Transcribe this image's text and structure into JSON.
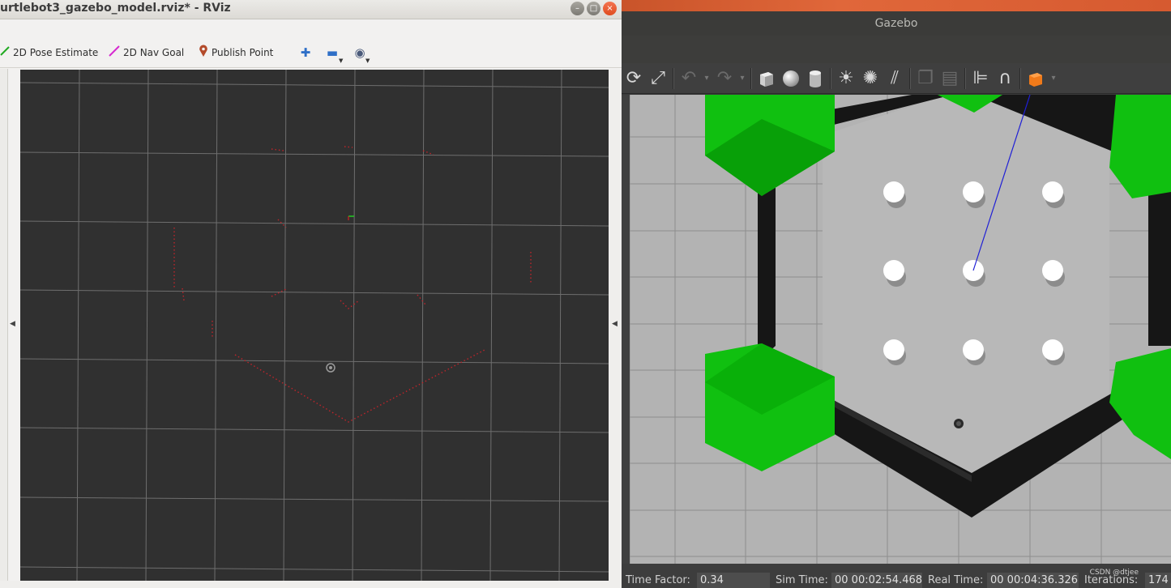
{
  "rviz": {
    "title": "urtlebot3_gazebo_model.rviz* - RViz",
    "window_buttons": {
      "minimize": "–",
      "maximize": "□",
      "close": "×"
    },
    "tools": [
      {
        "label": "2D Pose Estimate",
        "icon": "green-arrow-icon",
        "color": "#22aa22"
      },
      {
        "label": "2D Nav Goal",
        "icon": "pink-arrow-icon",
        "color": "#d62ad0"
      },
      {
        "label": "Publish Point",
        "icon": "map-pin-icon",
        "color": "#b34a2a"
      }
    ],
    "toolbar_icons": [
      "plus-icon",
      "minus-icon",
      "eye-icon"
    ],
    "viewport_bg": "#303030",
    "scan_color": "#c0242a"
  },
  "gazebo": {
    "title": "Gazebo",
    "accent": "#e0673a",
    "status": {
      "time_factor_label": "Time Factor:",
      "time_factor_value": "0.34",
      "sim_time_label": "Sim Time:",
      "sim_time_value": "00 00:02:54.468",
      "real_time_label": "Real Time:",
      "real_time_value": "00 00:04:36.326",
      "iterations_label": "Iterations:",
      "iterations_value": "174"
    },
    "watermark": "CSDN @dtjee",
    "toolbar_icons": [
      "rotate-icon",
      "scale-icon",
      "undo-icon",
      "redo-icon",
      "box-icon",
      "sphere-icon",
      "cylinder-icon",
      "point-light-icon",
      "spot-light-icon",
      "directional-light-icon",
      "copy-icon",
      "paste-icon",
      "align-icon",
      "snap-icon",
      "view-angle-icon"
    ],
    "colors": {
      "ground": "#b3b3b3",
      "green_block": "#10c010",
      "wall": "#1a1a1a",
      "pillar": "#ffffff",
      "ray": "#1f1fd6"
    }
  }
}
